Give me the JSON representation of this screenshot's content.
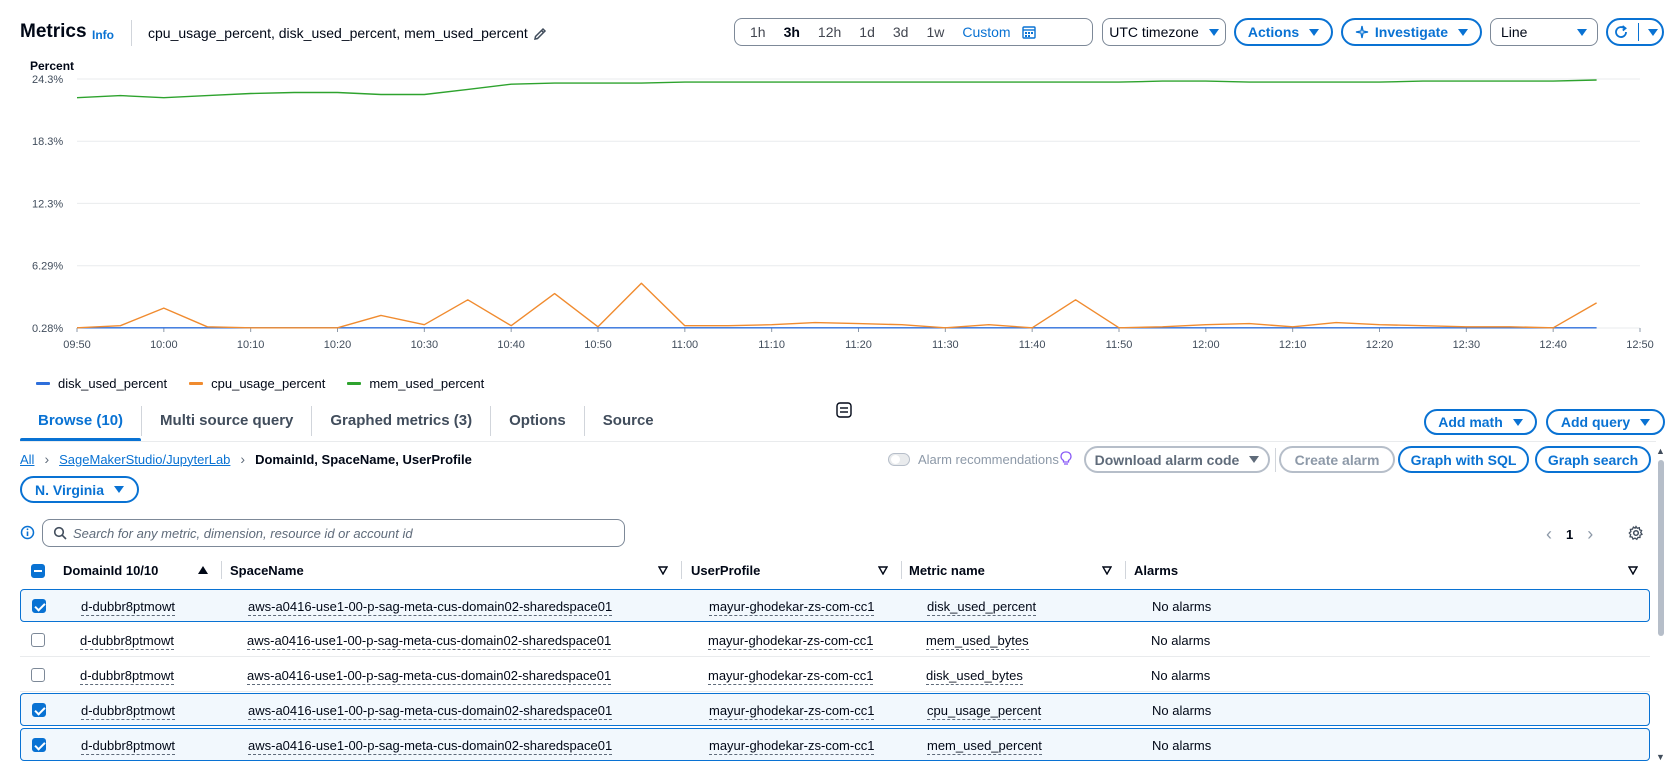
{
  "header": {
    "title": "Metrics",
    "info": "Info",
    "metrics_list": "cpu_usage_percent, disk_used_percent, mem_used_percent",
    "time_ranges": [
      "1h",
      "3h",
      "12h",
      "1d",
      "3d",
      "1w"
    ],
    "active_range": "3h",
    "custom_label": "Custom",
    "timezone": "UTC timezone",
    "actions": "Actions",
    "investigate": "Investigate",
    "view_type": "Line"
  },
  "chart_data": {
    "type": "line",
    "ylabel": "Percent",
    "y_ticks": [
      "24.3%",
      "18.3%",
      "12.3%",
      "6.29%",
      "0.28%"
    ],
    "y_tick_values": [
      24.3,
      18.3,
      12.3,
      6.29,
      0.28
    ],
    "ylim": [
      0.28,
      24.3
    ],
    "x_ticks": [
      "09:50",
      "10:00",
      "10:10",
      "10:20",
      "10:30",
      "10:40",
      "10:50",
      "11:00",
      "11:10",
      "11:20",
      "11:30",
      "11:40",
      "11:50",
      "12:00",
      "12:10",
      "12:20",
      "12:30",
      "12:40",
      "12:50"
    ],
    "x_minutes": [
      0,
      5,
      10,
      15,
      20,
      25,
      30,
      35,
      40,
      45,
      50,
      55,
      60,
      65,
      70,
      75,
      80,
      85,
      90,
      95,
      100,
      105,
      110,
      115,
      120,
      125,
      130,
      135,
      140,
      145,
      150,
      155,
      160,
      165,
      170,
      175
    ],
    "xlim_minutes": [
      0,
      180
    ],
    "series": [
      {
        "name": "disk_used_percent",
        "color": "#2e6fdb",
        "values": [
          0.3,
          0.3,
          0.3,
          0.3,
          0.3,
          0.3,
          0.3,
          0.3,
          0.3,
          0.3,
          0.3,
          0.3,
          0.3,
          0.3,
          0.3,
          0.3,
          0.3,
          0.3,
          0.3,
          0.3,
          0.3,
          0.3,
          0.3,
          0.3,
          0.3,
          0.3,
          0.3,
          0.3,
          0.3,
          0.3,
          0.3,
          0.3,
          0.3,
          0.3,
          0.3,
          0.3
        ]
      },
      {
        "name": "cpu_usage_percent",
        "color": "#f08b2f",
        "values": [
          0.3,
          0.5,
          2.2,
          0.4,
          0.3,
          0.3,
          0.3,
          1.5,
          0.6,
          3.0,
          0.5,
          3.6,
          0.4,
          4.6,
          0.5,
          0.5,
          0.6,
          0.8,
          0.7,
          0.6,
          0.3,
          0.6,
          0.3,
          3.0,
          0.3,
          0.4,
          0.6,
          0.7,
          0.4,
          0.8,
          0.6,
          0.5,
          0.4,
          0.4,
          0.3,
          2.7
        ]
      },
      {
        "name": "mem_used_percent",
        "color": "#2ea32e",
        "values": [
          22.5,
          22.7,
          22.5,
          22.7,
          22.9,
          23.0,
          23.0,
          22.8,
          22.8,
          23.3,
          23.8,
          23.9,
          23.9,
          23.9,
          24.0,
          24.0,
          24.0,
          24.0,
          24.0,
          24.0,
          24.0,
          24.0,
          24.0,
          24.0,
          24.0,
          24.1,
          24.1,
          24.0,
          24.0,
          24.0,
          24.0,
          24.1,
          24.1,
          24.1,
          24.1,
          24.2
        ]
      }
    ],
    "legend": "bottom-left",
    "grid": true
  },
  "tabs": [
    {
      "label": "Browse (10)",
      "active": true
    },
    {
      "label": "Multi source query"
    },
    {
      "label": "Graphed metrics (3)"
    },
    {
      "label": "Options"
    },
    {
      "label": "Source"
    }
  ],
  "buttons": {
    "add_math": "Add math",
    "add_query": "Add query",
    "download_alarm_code": "Download alarm code",
    "create_alarm": "Create alarm",
    "graph_with_sql": "Graph with SQL",
    "graph_search": "Graph search",
    "region": "N. Virginia"
  },
  "breadcrumb": {
    "all": "All",
    "namespace": "SageMakerStudio/JupyterLab",
    "current": "DomainId, SpaceName, UserProfile"
  },
  "alarm_recommendations": "Alarm recommendations",
  "search": {
    "placeholder": "Search for any metric, dimension, resource id or account id"
  },
  "pager": {
    "page": "1"
  },
  "table": {
    "columns": [
      "DomainId 10/10",
      "SpaceName",
      "UserProfile",
      "Metric name",
      "Alarms"
    ],
    "rows": [
      {
        "checked": true,
        "domain": "d-dubbr8ptmowt",
        "space": "aws-a0416-use1-00-p-sag-meta-cus-domain02-sharedspace01",
        "user": "mayur-ghodekar-zs-com-cc1",
        "metric": "disk_used_percent",
        "alarms": "No alarms"
      },
      {
        "checked": false,
        "domain": "d-dubbr8ptmowt",
        "space": "aws-a0416-use1-00-p-sag-meta-cus-domain02-sharedspace01",
        "user": "mayur-ghodekar-zs-com-cc1",
        "metric": "mem_used_bytes",
        "alarms": "No alarms"
      },
      {
        "checked": false,
        "domain": "d-dubbr8ptmowt",
        "space": "aws-a0416-use1-00-p-sag-meta-cus-domain02-sharedspace01",
        "user": "mayur-ghodekar-zs-com-cc1",
        "metric": "disk_used_bytes",
        "alarms": "No alarms"
      },
      {
        "checked": true,
        "domain": "d-dubbr8ptmowt",
        "space": "aws-a0416-use1-00-p-sag-meta-cus-domain02-sharedspace01",
        "user": "mayur-ghodekar-zs-com-cc1",
        "metric": "cpu_usage_percent",
        "alarms": "No alarms"
      },
      {
        "checked": true,
        "domain": "d-dubbr8ptmowt",
        "space": "aws-a0416-use1-00-p-sag-meta-cus-domain02-sharedspace01",
        "user": "mayur-ghodekar-zs-com-cc1",
        "metric": "mem_used_percent",
        "alarms": "No alarms"
      }
    ]
  },
  "colors": {
    "accent": "#0972d3",
    "selected_bg": "#f2f8fd"
  }
}
